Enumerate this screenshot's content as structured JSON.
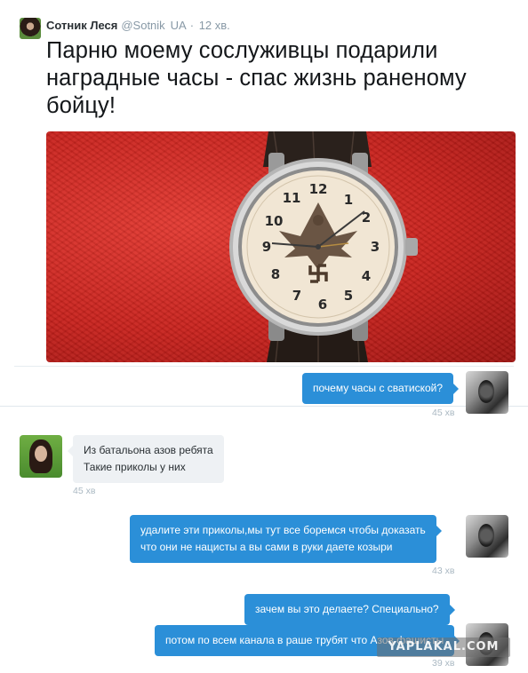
{
  "tweet": {
    "author_name": "Сотник Леся",
    "handle": "@Sotnik",
    "flag": "UA",
    "dot": "·",
    "time": "12 хв.",
    "text": "Парню моему сослуживцы подарили наградные часы - спас жизнь раненому бойцу!",
    "media_icon": "watch-photo"
  },
  "chat": {
    "messages": [
      {
        "side": "out",
        "text_lines": [
          "почему часы с сватиской?"
        ],
        "time": "45 хв"
      },
      {
        "side": "in",
        "text_lines": [
          "Из батальона азов ребята",
          "Такие приколы у них"
        ],
        "time": "45 хв"
      },
      {
        "side": "out",
        "text_lines": [
          "удалите эти приколы,мы тут все боремся чтобы доказать",
          "что они не нацисты а вы сами в руки даете козыри"
        ],
        "time": "43 хв"
      },
      {
        "side": "out",
        "text_lines": [
          "зачем вы это делаете? Специально?"
        ],
        "time": ""
      },
      {
        "side": "out",
        "text_lines": [
          "потом по всем канала в раше трубят что Азов фашисты"
        ],
        "time": "39 хв"
      }
    ]
  },
  "watermark": "YAPLAKAL.COM",
  "colors": {
    "bubble_out": "#2b8fd8",
    "bubble_in": "#eef1f4",
    "timestamp": "#aab8c2",
    "photo_red": "#c8221d"
  }
}
